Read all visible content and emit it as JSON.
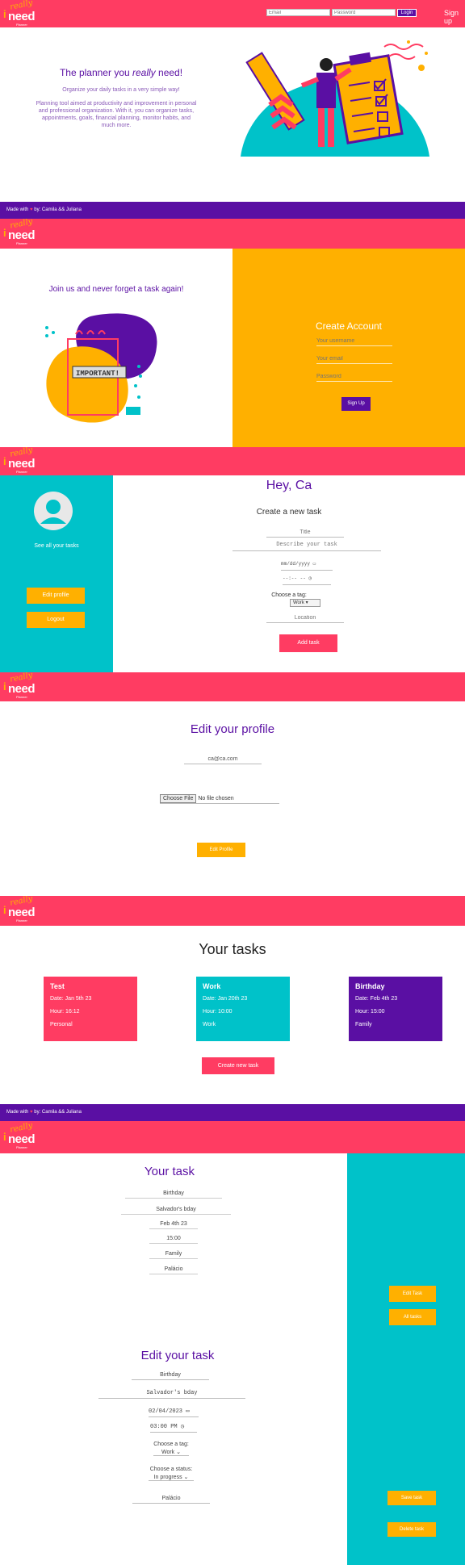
{
  "logo": {
    "really": "really",
    "i": "i",
    "need": "need",
    "planner": "Planner"
  },
  "landing": {
    "email_placeholder": "Email",
    "password_placeholder": "Password",
    "login_label": "Login",
    "signup_link": "Sign up",
    "headline_prefix": "The planner you ",
    "headline_emphasis": "really",
    "headline_suffix": " need!",
    "subtitle": "Organize your daily tasks in a very simple way!",
    "description": "Planning tool aimed at productivity and improvement in personal and professional organization. With it, you can organize tasks, appointments, goals, financial planning, monitor habits, and much more.",
    "footer_prefix": "Made with ",
    "footer_heart": "♥",
    "footer_suffix": " by: Camila && Juliana"
  },
  "signup": {
    "join_text": "Join us and never forget a task again!",
    "important_text": "IMPORTANT!",
    "title": "Create Account",
    "username_placeholder": "Your username",
    "email_placeholder": "Your email",
    "password_placeholder": "Password",
    "button": "Sign Up"
  },
  "dashboard": {
    "greeting": "Hey, Ca",
    "see_tasks": "See all your tasks",
    "edit_profile": "Edit profile",
    "logout": "Logout",
    "form_title": "Create a new task",
    "title_placeholder": "Title",
    "describe_placeholder": "Describe your task",
    "date_placeholder": "mm/dd/yyyy",
    "time_placeholder": "--:-- --",
    "tag_label": "Choose a tag:",
    "tag_value": "Work",
    "location_placeholder": "Location",
    "add_button": "Add task"
  },
  "edit_profile": {
    "title": "Edit your profile",
    "email_value": "ca@ca.com",
    "choose_file": "Choose File",
    "no_file": "No file chosen",
    "button": "Edit Profile"
  },
  "tasks": {
    "title": "Your tasks",
    "cards": [
      {
        "title": "Test",
        "date": "Date: Jan 5th 23",
        "hour": "Hour: 16:12",
        "tag": "Personal",
        "color": "#ff3c62"
      },
      {
        "title": "Work",
        "date": "Date: Jan 20th 23",
        "hour": "Hour: 10:00",
        "tag": "Work",
        "color": "#00c2c9"
      },
      {
        "title": "Birthday",
        "date": "Date: Feb 4th 23",
        "hour": "Hour: 15:00",
        "tag": "Family",
        "color": "#5a0fa3"
      }
    ],
    "create_button": "Create new task",
    "footer_prefix": "Made with ",
    "footer_heart": "♥",
    "footer_suffix": " by: Camila && Juliana"
  },
  "task_detail": {
    "title": "Your task",
    "fields": [
      "Birthday",
      "Salvador's bday",
      "Feb 4th 23",
      "15:00",
      "Family",
      "Palácio"
    ],
    "edit_button": "Edit Task",
    "all_button": "All tasks"
  },
  "edit_task": {
    "title": "Edit your task",
    "title_value": "Birthday",
    "describe_value": "Salvador's bday",
    "date_value": "02/04/2023",
    "time_value": "03:00 PM",
    "tag_label": "Choose a tag:",
    "tag_value": "Work",
    "status_label": "Choose a status:",
    "status_value": "In progress",
    "location_value": "Palácio",
    "save_button": "Save task",
    "delete_button": "Delete task"
  },
  "colors": {
    "pink": "#ff3c62",
    "purple": "#5a0fa3",
    "yellow": "#ffb000",
    "teal": "#00c2c9"
  }
}
